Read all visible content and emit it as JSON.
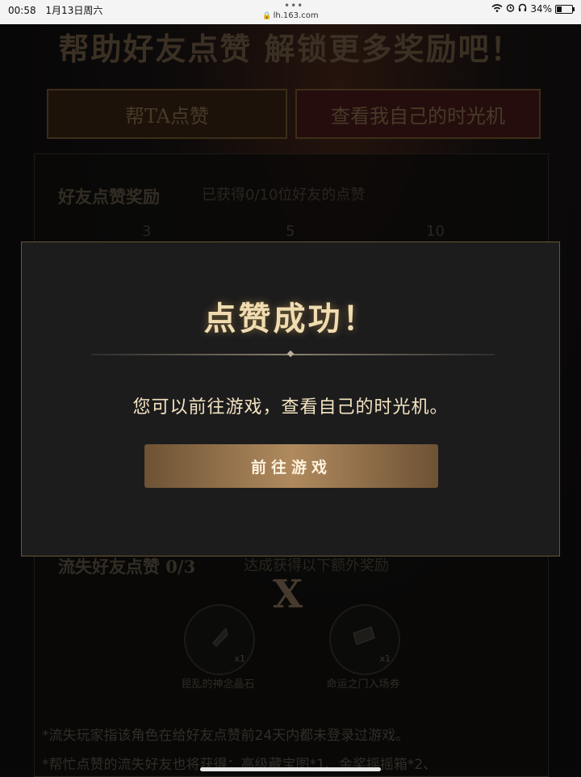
{
  "status_bar": {
    "time": "00:58",
    "date": "1月13日周六",
    "url": "lh.163.com",
    "battery": "34%",
    "battery_level": 0.34
  },
  "background": {
    "headline": "帮助好友点赞 解锁更多奖励吧！",
    "button_like": "帮TA点赞",
    "button_view": "查看我自己的时光机",
    "friend_section_title": "好友点赞奖励",
    "friend_section_progress": "已获得0/10位好友的点赞",
    "milestones": [
      "3",
      "5",
      "10"
    ],
    "lost_section_title": "流失好友点赞 0/3",
    "lost_section_sub": "达成获得以下额外奖励",
    "x_mark": "X",
    "rewards": [
      {
        "label": "昆乱的神念晶石",
        "qty": "x1"
      },
      {
        "label": "命运之门入场券",
        "qty": "x1"
      }
    ],
    "notes": [
      "*流失玩家指该角色在给好友点赞前24天内都未登录过游戏。",
      "*帮忙点赞的流失好友也将获得：高级藏宝图*1、金奖摇摇箱*2、"
    ]
  },
  "modal": {
    "title": "点赞成功！",
    "message": "您可以前往游戏，查看自己的时光机。",
    "button_label": "前往游戏"
  },
  "colors": {
    "modal_bg": "#1c1c1d",
    "modal_border": "#6a5533",
    "accent_gold": "#b08a5e",
    "title_text": "#f0dcb0"
  }
}
